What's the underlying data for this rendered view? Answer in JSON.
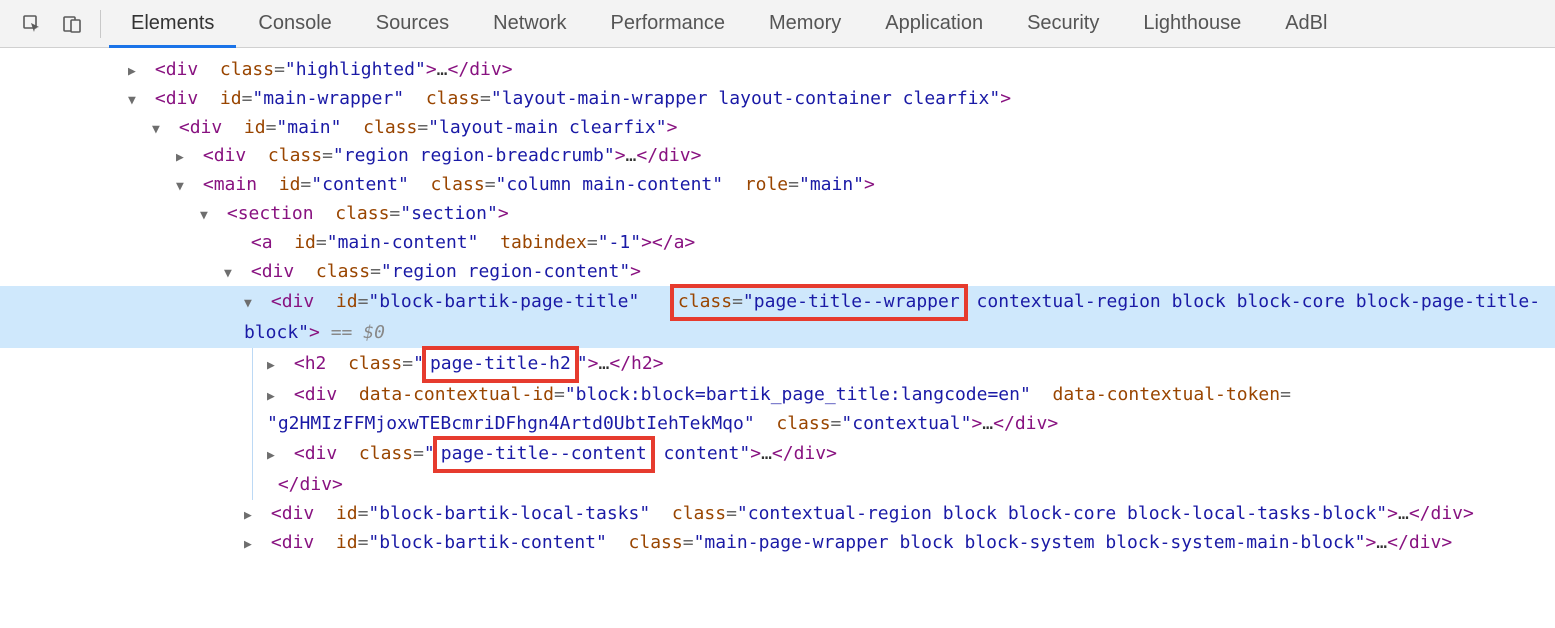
{
  "toolbar": {
    "tabs": [
      "Elements",
      "Console",
      "Sources",
      "Network",
      "Performance",
      "Memory",
      "Application",
      "Security",
      "Lighthouse",
      "AdBl"
    ],
    "active": "Elements"
  },
  "gutter": "•••",
  "lines": {
    "l0": {
      "tag": "div",
      "attrs": "class=\"highlighted\"",
      "collapsed": true
    },
    "l1": {
      "tag": "div",
      "attrs": "id=\"main-wrapper\" class=\"layout-main-wrapper layout-container clearfix\""
    },
    "l2": {
      "tag": "div",
      "attrs": "id=\"main\" class=\"layout-main clearfix\""
    },
    "l3": {
      "tag": "div",
      "attrs": "class=\"region region-breadcrumb\"",
      "collapsed": true
    },
    "l4": {
      "tag": "main",
      "attrs": "id=\"content\" class=\"column main-content\" role=\"main\""
    },
    "l5": {
      "tag": "section",
      "attrs": "class=\"section\""
    },
    "l6": {
      "tag": "a",
      "attrs": "id=\"main-content\" tabindex=\"-1\""
    },
    "l7": {
      "tag": "div",
      "attrs": "class=\"region region-content\""
    },
    "l8": {
      "tag": "div",
      "attrs_pre": "id=\"block-bartik-page-title\" ",
      "attr_class_label": "class",
      "box1": "page-title--wrapper",
      "attrs_post": " contextual-region block block-core block-page-title-block\"",
      "eq_comment": " == $0"
    },
    "l9": {
      "tag": "h2",
      "attr_class_label": "class",
      "box": "page-title-h2"
    },
    "l10": {
      "tag": "div",
      "attrs_a": "data-contextual-id=\"block:block=bartik_page_title:langcode=en\" data-contextual-token=",
      "attrs_b": "\"g2HMIzFFMjoxwTEBcmriDFhgn4Artd0UbtIehTekMqo\" class=\"contextual\"",
      "collapsed": true
    },
    "l11": {
      "tag": "div",
      "attr_class_label": "class",
      "box": "page-title--content",
      "post": " content\"",
      "collapsed": true
    },
    "l12": {
      "close": "div"
    },
    "l13": {
      "tag": "div",
      "attrs": "id=\"block-bartik-local-tasks\" class=\"contextual-region block block-core block-local-tasks-block\"",
      "collapsed": true
    },
    "l14": {
      "tag": "div",
      "attrs": "id=\"block-bartik-content\" class=\"main-page-wrapper block block-system block-system-main-block\"",
      "collapsed": true
    }
  }
}
